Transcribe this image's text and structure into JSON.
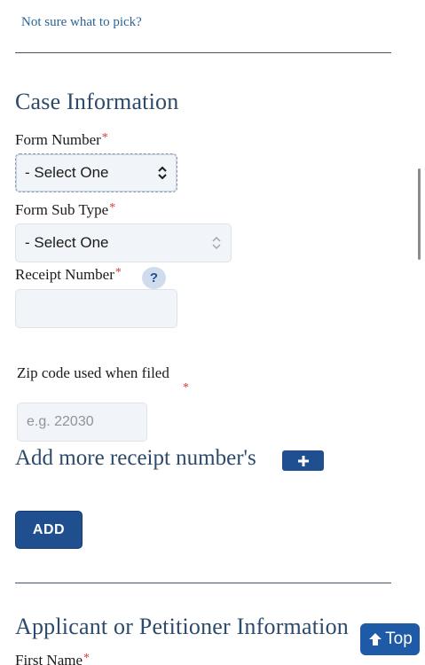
{
  "help_link": "Not sure what to pick?",
  "case_section": {
    "title": "Case Information",
    "form_number": {
      "label": "Form Number",
      "required": "*",
      "value": "- Select One"
    },
    "form_sub_type": {
      "label": "Form Sub Type",
      "required": "*",
      "value": "- Select One"
    },
    "receipt_number": {
      "label": "Receipt Number",
      "required": "*",
      "help": "?",
      "value": ""
    },
    "zip_code": {
      "label": "Zip code used when filed",
      "required": "*",
      "placeholder": "e.g. 22030"
    },
    "add_more": {
      "label": "Add more receipt number's",
      "icon": "plus-icon"
    },
    "add_button": "ADD"
  },
  "applicant_section": {
    "title": "Applicant or Petitioner Information",
    "first_name": {
      "label": "First Name",
      "required": "*"
    }
  },
  "top_button": {
    "label": "Top",
    "icon": "arrow-up-icon"
  },
  "colors": {
    "accent": "#1f4f8f",
    "heading": "#2c4a6b",
    "required": "#d83933",
    "field_bg": "#f1f4f8"
  }
}
